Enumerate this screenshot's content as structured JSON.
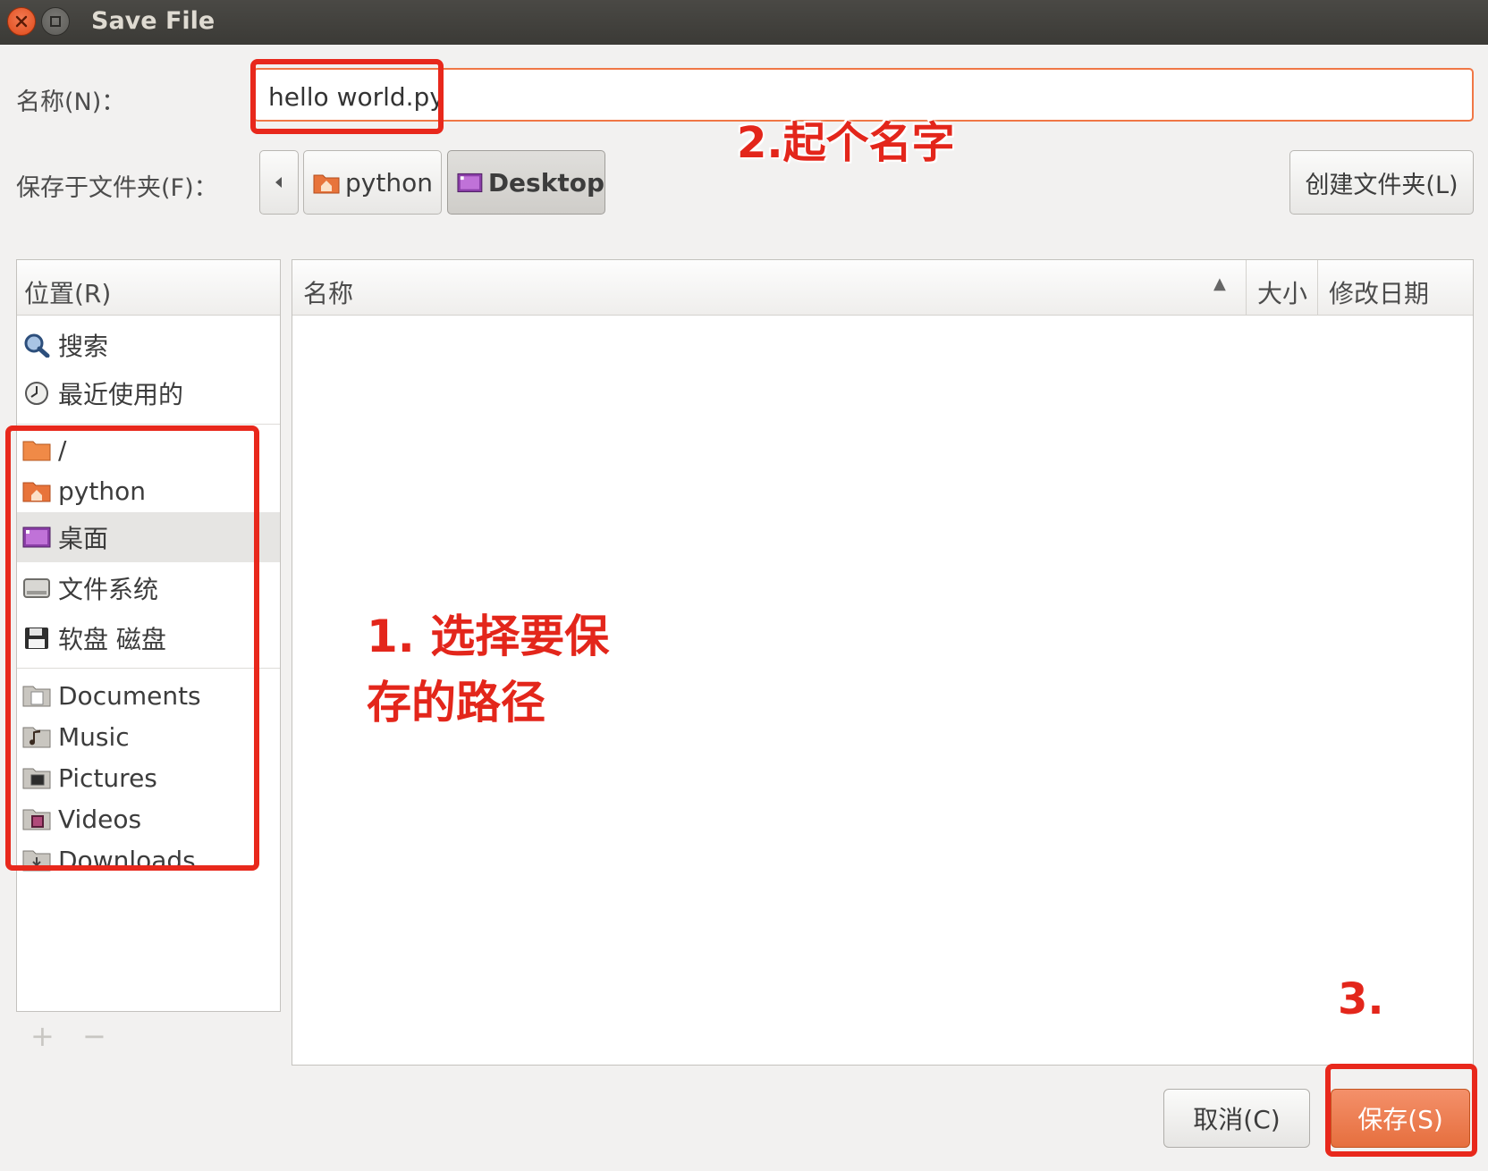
{
  "window": {
    "title": "Save File"
  },
  "name_row": {
    "label": "名称(N)：",
    "value": "hello world.py"
  },
  "folder_row": {
    "label": "保存于文件夹(F)：",
    "crumbs": [
      {
        "label": "python",
        "icon": "home-folder-icon",
        "active": false
      },
      {
        "label": "Desktop",
        "icon": "desktop-icon",
        "active": true
      }
    ],
    "create_folder_label": "创建文件夹(L)"
  },
  "places": {
    "header": "位置(R)",
    "items": [
      {
        "label": "搜索",
        "icon": "search-icon"
      },
      {
        "label": "最近使用的",
        "icon": "recent-icon"
      },
      {
        "label": "/",
        "icon": "folder-icon"
      },
      {
        "label": "python",
        "icon": "home-folder-icon"
      },
      {
        "label": "桌面",
        "icon": "desktop-icon",
        "selected": true
      },
      {
        "label": "文件系统",
        "icon": "drive-icon"
      },
      {
        "label": "软盘 磁盘",
        "icon": "floppy-icon"
      },
      {
        "label": "Documents",
        "icon": "documents-folder-icon"
      },
      {
        "label": "Music",
        "icon": "music-folder-icon"
      },
      {
        "label": "Pictures",
        "icon": "pictures-folder-icon"
      },
      {
        "label": "Videos",
        "icon": "videos-folder-icon"
      },
      {
        "label": "Downloads",
        "icon": "downloads-folder-icon"
      }
    ],
    "add": "+",
    "remove": "−"
  },
  "file_list": {
    "columns": {
      "name": "名称",
      "size": "大小",
      "modified": "修改日期"
    },
    "sort_indicator": "▲",
    "rows": []
  },
  "buttons": {
    "cancel": "取消(C)",
    "save": "保存(S)"
  },
  "annotations": {
    "step1_line1": "1. 选择要保",
    "step1_line2": "存的路径",
    "step2": "2.起个名字",
    "step3": "3."
  },
  "colors": {
    "accent": "#e66f3e",
    "annotation": "#e8281c",
    "titlebar": "#3c3b37"
  }
}
